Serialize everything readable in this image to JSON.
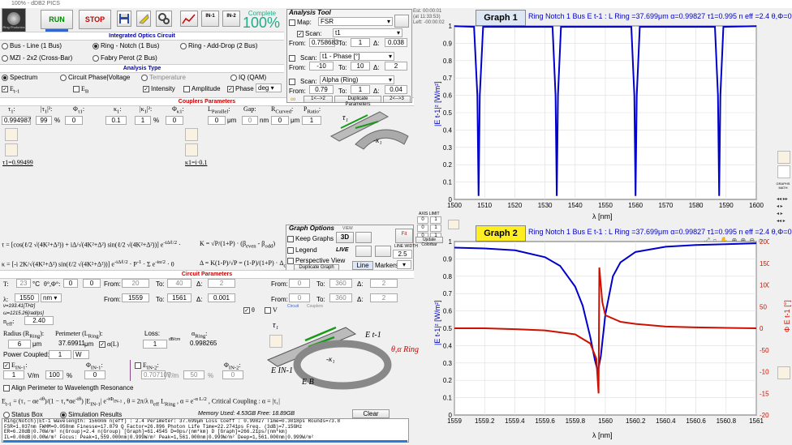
{
  "window": {
    "title": "100% - dDB2 PICS"
  },
  "toolbar": {
    "run": "RUN",
    "stop": "STOP",
    "complete_label": "Complete",
    "complete_pct": "100%",
    "logo_text": "Ring Photonics",
    "times": [
      "Est:  00:00:01",
      "(at 11:33:53)",
      "Left:  -00:00:02"
    ]
  },
  "sections": {
    "circuit": "Integrated Optics Circuit",
    "analysis_type": "Analysis Type",
    "couplers": "Couplers Parameters",
    "circuit_params": "Circuit Parameters"
  },
  "circuits": [
    "Bus - Line (1 Bus)",
    "Ring - Notch (1 Bus)",
    "Ring - Add-Drop (2 Bus)",
    "MZI - 2x2 (Cross-Bar)",
    "Fabry Perot (2 Bus)"
  ],
  "analysis": {
    "types": [
      "Spectrum",
      "Circuit Phase|Voltage",
      "Temperature",
      "IQ (QAM)"
    ],
    "outputs": [
      "Intensity",
      "Amplitude",
      "Phase"
    ],
    "phase_unit": "deg"
  },
  "couplers": {
    "tau1": "0.994987",
    "k1sq": "99",
    "phi": "0",
    "kappa1": "0.1",
    "kappa_pct": "1",
    "phi2": "0",
    "l_parallel": "0",
    "gap": "0",
    "r_curved": "0",
    "p_ratio": "1",
    "unit_pct": "%",
    "unit_um": "μm",
    "unit_nm": "nm",
    "tau_lbl": "τ1=0.99499",
    "kappa_lbl": "κ1=i·0.1"
  },
  "analysis_tool": {
    "title": "Analysis Tool",
    "map_label": "Map:",
    "map_value": "FSR",
    "scan1_label": "Scan:",
    "scan1_value": "t1",
    "from1": "0.758683",
    "to1": "1",
    "d1": "0.038",
    "scan2_value": "t1 - Phase [°]",
    "from2": "-10",
    "to2": "10",
    "d2": "2",
    "scan3_value": "Alpha (Ring)",
    "from3": "0.79",
    "to3": "1",
    "d3": "0.04",
    "from_lbl": "From:",
    "to_lbl": "To:",
    "delta_lbl": "Δ:",
    "b12": "1<-->2",
    "dup": "Duplicate Parameters",
    "b23": "2<-->3"
  },
  "graph_options": {
    "title": "Graph Options",
    "keep": "Keep Graphs",
    "legend": "Legend",
    "persp": "Perspective View",
    "dup": "Duplicate Graph",
    "line": "Line",
    "markers": "Markers",
    "line_width_lbl": "LINE WIDTH",
    "line_width": "2.5",
    "axis_limit": "AXIS LIMIT",
    "update": "Update Colorbar",
    "view_lbl": "VIEW",
    "view_3d": "3D",
    "live": "LIVE",
    "axis": [
      "0",
      "1",
      "0",
      "1",
      "0",
      "1"
    ]
  },
  "circuit_params": {
    "temp": "23",
    "temp_unit": "°C",
    "lambda": "1550",
    "lambda_unit": "nm",
    "from1": "20",
    "to1": "40",
    "d1": "2",
    "from2": "1559",
    "to2": "1561",
    "d2": "0.001",
    "from3": "0",
    "to3": "360",
    "d3": "2",
    "from4": "0",
    "to4": "360",
    "d4": "2",
    "freq": "ν=193.41[THz]",
    "omega": "ω=1215.26[rad/ps]",
    "neff": "2.40",
    "radius": "6",
    "radius_unit": "μm",
    "perimeter": "37.69911",
    "perimeter_unit": "μm",
    "loss": "1",
    "loss_unit": "dB/cm",
    "alpha_ring": "0.998265",
    "power_coupled": "1",
    "power_unit": "W",
    "ein1": "1",
    "ein1_unit": "V/m",
    "ein1_pct": "100",
    "ein1_phase": "0",
    "ein2": "0.707107",
    "ein2_unit": "V/m",
    "ein2_pct": "50",
    "ein2_phase": "0",
    "align": "Align Perimeter to Wavelength Resonance",
    "circuit_tab": "Circuit",
    "couplers_tab": "Couplers"
  },
  "status": {
    "box": "Status Box",
    "sim": "Simulation Results",
    "memory": "Memory Used: 4.53GB  Free: 18.89GB",
    "clear": "Clear",
    "lines": [
      "Ring(Notch)|Et-1    Wavelength: 1560nm    n(eff) : 2.4    Perimeter: 37.699μm    Loss Coeff : 0.99827    Time=0.3018ps    Rounds=73.8",
      "FSR=1.037nm    FWHM=0.058nm    Finesse=17.879    Q Factor=26.896    Photon Life Time=22.2741ps    Freq. (3dB)=7.15GHz",
      "ER=6.28dB|0.76W/m²    n(Group)=2.4    n(Group)  [Graph]=61.4545    D=0ps/(nm*km)    D [Graph]=266.21ps/(nm*km)",
      "IL=0.00dB|0.00W/m²    Focus: Peak=1,559.000nm|0.999W/m²    Peak=1,561.000nm|0.999W/m²    Deep=1,561.000nm|0.999W/m²"
    ]
  },
  "graph1": {
    "title": "Graph 1",
    "header": "Ring Notch 1 Bus E t-1 : L Ring =37.699μm   α=0.99827   τ1=0.995   n eff =2.4   θ,Φ=0,0[°]",
    "ylabel": "|E t-1|² [W/m²]",
    "xlabel": "λ [nm]",
    "xticks": [
      "1500",
      "1510",
      "1520",
      "1530",
      "1540",
      "1550",
      "1560",
      "1570",
      "1580",
      "1590",
      "1600"
    ],
    "yticks": [
      "1",
      "0.9",
      "0.8",
      "0.7",
      "0.6",
      "0.5",
      "0.4",
      "0.3",
      "0.2",
      "0.1",
      "0"
    ]
  },
  "graph2": {
    "title": "Graph 2",
    "header": "Ring Notch 1 Bus E t-1 : L Ring =37.699μm   α=0.99827   τ1=0.995   n eff =2.4   θ,Φ=0,0[°]",
    "ylabel": "|E t-1|² [W/m²]",
    "ylabel2": "Φ E t-1 [°]",
    "xlabel": "λ [nm]",
    "xticks": [
      "1559",
      "1559.2",
      "1559.4",
      "1559.6",
      "1559.8",
      "1560",
      "1560.2",
      "1560.4",
      "1560.6",
      "1560.8",
      "1561"
    ],
    "yticks": [
      "1",
      "0.9",
      "0.8",
      "0.7",
      "0.6",
      "0.5",
      "0.4",
      "0.3",
      "0.2",
      "0.1",
      "0"
    ],
    "y2ticks": [
      "200",
      "150",
      "100",
      "50",
      "0",
      "-50",
      "-100",
      "-150",
      "-200"
    ]
  },
  "side": {
    "graph_math": "GRAPHS MATH"
  },
  "colors": {
    "intensity": "#0000cc",
    "phase": "#cc1100",
    "run": "#008800",
    "stop": "#cc0000",
    "graph1_title_bg": "#dde6f5",
    "graph2_title_bg": "#ffee22",
    "section": "#0000aa",
    "section_red": "#cc0000"
  },
  "chart_data": [
    {
      "type": "line",
      "title": "Graph 1",
      "xlabel": "λ [nm]",
      "ylabel": "|E t-1|² [W/m²]",
      "xlim": [
        1500,
        1600
      ],
      "ylim": [
        0,
        1
      ],
      "grid": true,
      "series": [
        {
          "values": "notch spectrum",
          "x": [
            1500,
            1506.5,
            1507.6,
            1508.0,
            1508.4,
            1509.5,
            1532.5,
            1533.5,
            1533.9,
            1534.3,
            1535.3,
            1558.6,
            1559.6,
            1560.0,
            1560.4,
            1561.4,
            1586.3,
            1587.3,
            1587.7,
            1588.1,
            1589.1,
            1600
          ],
          "y": [
            0.999,
            0.995,
            0.6,
            0.02,
            0.6,
            0.995,
            0.995,
            0.6,
            0.02,
            0.6,
            0.995,
            0.995,
            0.6,
            0.02,
            0.6,
            0.995,
            0.995,
            0.6,
            0.02,
            0.6,
            0.995,
            0.999
          ]
        }
      ]
    },
    {
      "type": "line",
      "title": "Graph 2",
      "xlabel": "λ [nm]",
      "ylabel": "|E t-1|² [W/m²]",
      "y2label": "Φ E t-1 [°]",
      "xlim": [
        1559,
        1561
      ],
      "ylim": [
        0,
        1
      ],
      "y2lim": [
        -200,
        200
      ],
      "grid": true,
      "series": [
        {
          "values": "intensity",
          "x": [
            1559,
            1559.2,
            1559.4,
            1559.6,
            1559.7,
            1559.8,
            1559.85,
            1559.9,
            1559.93,
            1559.95,
            1559.97,
            1560.0,
            1560.05,
            1560.1,
            1560.2,
            1560.4,
            1560.6,
            1560.8,
            1561
          ],
          "y": [
            0.965,
            0.96,
            0.95,
            0.91,
            0.86,
            0.74,
            0.63,
            0.45,
            0.32,
            0.25,
            0.34,
            0.58,
            0.8,
            0.88,
            0.94,
            0.97,
            0.98,
            0.985,
            0.99
          ]
        },
        {
          "values": "phase",
          "x": [
            1559,
            1559.2,
            1559.4,
            1559.6,
            1559.8,
            1559.9,
            1559.94,
            1559.955,
            1559.96,
            1559.98,
            1560.0,
            1560.1,
            1560.2,
            1560.4,
            1560.6,
            1560.8,
            1561
          ],
          "y": [
            0,
            0,
            -2,
            -5,
            -14,
            -35,
            -70,
            -150,
            140,
            60,
            30,
            15,
            10,
            4,
            2,
            1,
            0
          ]
        }
      ]
    }
  ]
}
